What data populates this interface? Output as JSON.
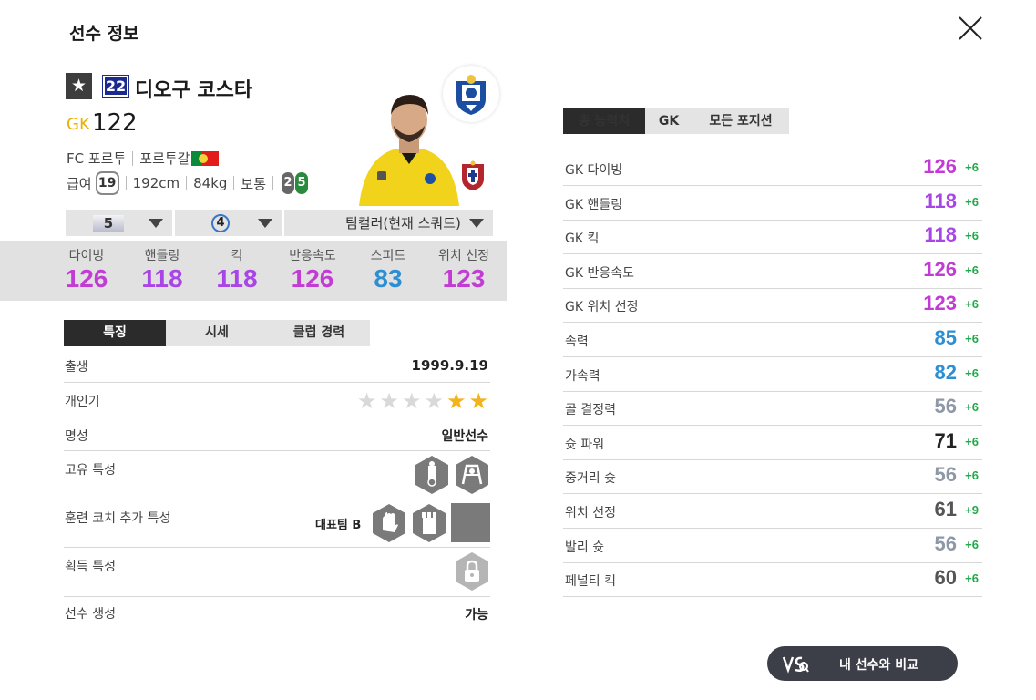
{
  "page": {
    "title": "선수 정보"
  },
  "player": {
    "number": "22",
    "name": "디오구 코스타",
    "position": "GK",
    "ovr": "122",
    "club": "FC 포르투",
    "nation": "포르투갈",
    "salary_label": "급여",
    "salary": "19",
    "height": "192cm",
    "weight": "84kg",
    "body_type": "보통",
    "foot_left": "2",
    "foot_right": "5"
  },
  "selectors": {
    "level": "5",
    "grade": "4",
    "team_color": "팀컬러(현재 스쿼드)"
  },
  "stats": [
    {
      "label": "다이빙",
      "value": "126",
      "color": "#c23bd4"
    },
    {
      "label": "핸들링",
      "value": "118",
      "color": "#a945e6"
    },
    {
      "label": "킥",
      "value": "118",
      "color": "#a945e6"
    },
    {
      "label": "반응속도",
      "value": "126",
      "color": "#c23bd4"
    },
    {
      "label": "스피드",
      "value": "83",
      "color": "#2d8fd3"
    },
    {
      "label": "위치 선정",
      "value": "123",
      "color": "#c23bd4"
    }
  ],
  "left_tabs": [
    "특징",
    "시세",
    "클럽 경력"
  ],
  "details": {
    "birth_label": "출생",
    "birth": "1999.9.19",
    "popularity_label": "개인기",
    "popularity": 2,
    "fame_label": "명성",
    "fame": "일반선수",
    "unique_trait_label": "고유 특성",
    "coach_trait_label": "훈련 코치 추가 특성",
    "coach_trait_value": "대표팀 B",
    "acquired_trait_label": "획득 특성",
    "creation_label": "선수 생성",
    "creation": "가능"
  },
  "right_tabs": [
    "총 능력치",
    "GK",
    "모든 포지션"
  ],
  "attributes": [
    {
      "name": "GK 다이빙",
      "value": "126",
      "plus": "+6",
      "color": "#c23bd4"
    },
    {
      "name": "GK 핸들링",
      "value": "118",
      "plus": "+6",
      "color": "#a945e6"
    },
    {
      "name": "GK 킥",
      "value": "118",
      "plus": "+6",
      "color": "#a945e6"
    },
    {
      "name": "GK 반응속도",
      "value": "126",
      "plus": "+6",
      "color": "#c23bd4"
    },
    {
      "name": "GK 위치 선정",
      "value": "123",
      "plus": "+6",
      "color": "#c23bd4"
    },
    {
      "name": "속력",
      "value": "85",
      "plus": "+6",
      "color": "#2d8fd3"
    },
    {
      "name": "가속력",
      "value": "82",
      "plus": "+6",
      "color": "#2d8fd3"
    },
    {
      "name": "골 결정력",
      "value": "56",
      "plus": "+6",
      "color": "#8e98a6"
    },
    {
      "name": "슛 파워",
      "value": "71",
      "plus": "+6",
      "color": "#222222"
    },
    {
      "name": "중거리 슛",
      "value": "56",
      "plus": "+6",
      "color": "#8e98a6"
    },
    {
      "name": "위치 선정",
      "value": "61",
      "plus": "+9",
      "color": "#555555"
    },
    {
      "name": "발리 슛",
      "value": "56",
      "plus": "+6",
      "color": "#8e98a6"
    },
    {
      "name": "페널티 킥",
      "value": "60",
      "plus": "+6",
      "color": "#555555"
    }
  ],
  "compare_button": "내 선수와 비교"
}
